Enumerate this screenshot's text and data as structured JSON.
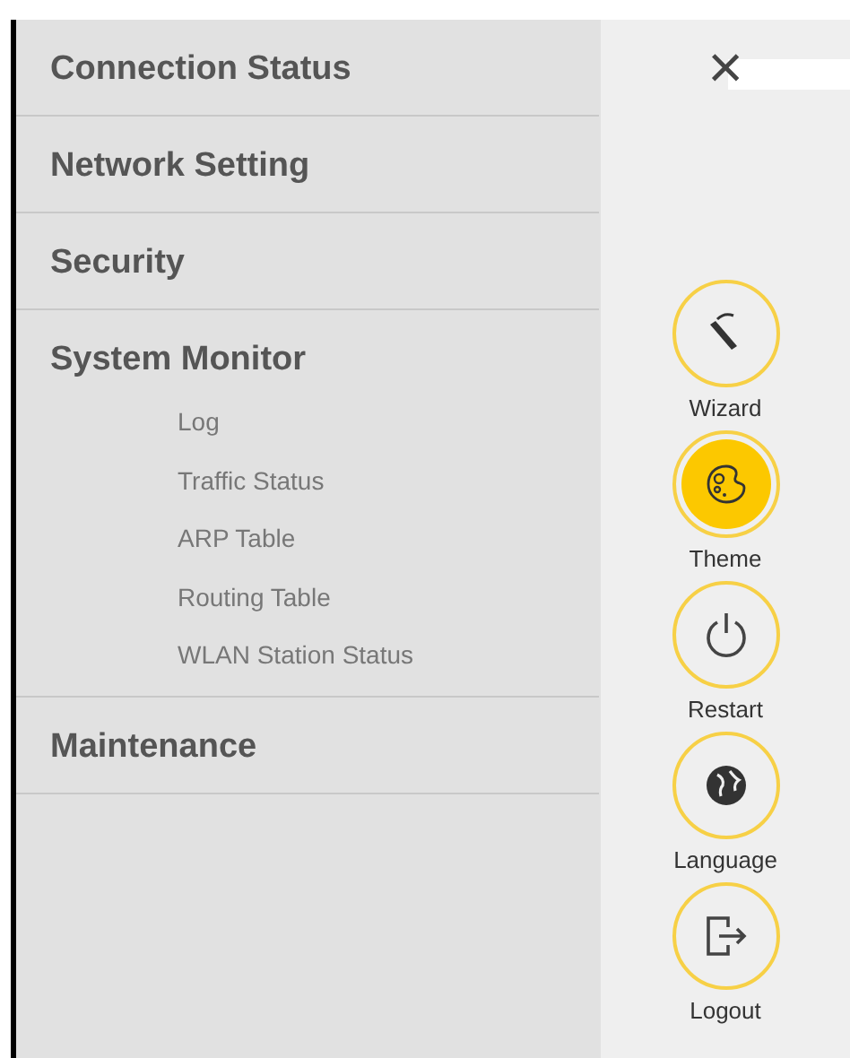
{
  "menu": [
    {
      "label": "Connection Status"
    },
    {
      "label": "Network Setting"
    },
    {
      "label": "Security"
    },
    {
      "label": "System Monitor",
      "expanded": true,
      "children": [
        {
          "label": "Log"
        },
        {
          "label": "Traffic Status"
        },
        {
          "label": "ARP Table"
        },
        {
          "label": "Routing Table"
        },
        {
          "label": "WLAN Station Status"
        }
      ]
    },
    {
      "label": "Maintenance"
    }
  ],
  "close_button": {
    "label": "×"
  },
  "actions": [
    {
      "kind": "wizard",
      "label": "Wizard",
      "selected": false
    },
    {
      "kind": "theme",
      "label": "Theme",
      "selected": true
    },
    {
      "kind": "restart",
      "label": "Restart",
      "selected": false
    },
    {
      "kind": "language",
      "label": "Language",
      "selected": false
    },
    {
      "kind": "logout",
      "label": "Logout",
      "selected": false
    }
  ]
}
